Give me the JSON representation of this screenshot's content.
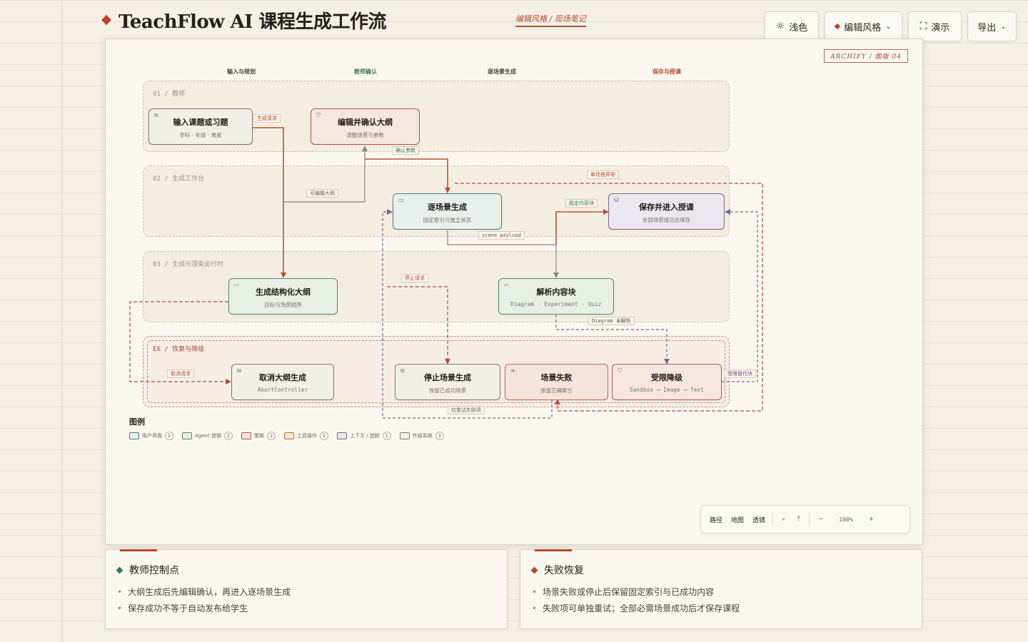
{
  "header": {
    "title": "TeachFlow AI 课程生成工作流",
    "style_note": "编辑风格 / 现场笔记"
  },
  "top_buttons": {
    "theme": "浅色",
    "theme_icon": "sun-icon",
    "style": "编辑风格",
    "present": "演示",
    "present_icon": "fullscreen-icon",
    "export": "导出"
  },
  "canvas": {
    "plate": "ARCHIFY / 图版 04",
    "columns": [
      "输入与规划",
      "教师确认",
      "逐场景生成",
      "保存与授课"
    ],
    "lanes": [
      "01 / 教师",
      "02 / 生成工作台",
      "03 / 生成与渲染运行时",
      "EX / 恢复与降级"
    ]
  },
  "nodes": {
    "input": {
      "title": "输入课题或习题",
      "sub": "学科 · 年级 · 难度"
    },
    "edit": {
      "title": "编辑并确认大纲",
      "sub": "调整场景与参数"
    },
    "scene": {
      "title": "逐场景生成",
      "sub": "固定索引与独立状态"
    },
    "save": {
      "title": "保存并进入授课",
      "sub": "全部场景成功后保存"
    },
    "outline": {
      "title": "生成结构化大纲",
      "sub": "目标与场景顺序"
    },
    "parse": {
      "title": "解析内容块",
      "sub": "Diagram · Experiment · Quiz"
    },
    "cancel": {
      "title": "取消大纲生成",
      "sub": "AbortController"
    },
    "stop": {
      "title": "停止场景生成",
      "sub": "保留已成功场景"
    },
    "fail": {
      "title": "场景失败",
      "sub": "保留正确索引"
    },
    "degrade": {
      "title": "受限降级",
      "sub": "Sandbox → Image → Text"
    }
  },
  "edges": {
    "gen_request": "生成请求",
    "confirm_params": "确认参数",
    "editable_outline": "可编辑大纲",
    "single_scene": "单场景异常",
    "stable_blocks": "稳定内容块",
    "scene_payload": "scene payload",
    "stop_request": "停止请求",
    "diagram_unparsed": "Diagram 未解析",
    "cancel_request": "取消请求",
    "restricted_alt": "受限替代块",
    "retry_failed": "仅重试失败项"
  },
  "legend": {
    "title": "图例",
    "items": [
      {
        "label": "用户界面",
        "count": "1",
        "fill": "#e8efec",
        "stroke": "#4a8076"
      },
      {
        "label": "Agent 逻辑",
        "count": "2",
        "fill": "#e7efe7",
        "stroke": "#5d8a66"
      },
      {
        "label": "策略",
        "count": "2",
        "fill": "#f6e6e1",
        "stroke": "#b8554a"
      },
      {
        "label": "工具操作",
        "count": "1",
        "fill": "#f5e4dc",
        "stroke": "#c66a4f"
      },
      {
        "label": "上下文 / 追踪",
        "count": "1",
        "fill": "#ece6ee",
        "stroke": "#7d6a8c"
      },
      {
        "label": "外部系统",
        "count": "3",
        "fill": "#f2efe8",
        "stroke": "#807a70"
      }
    ]
  },
  "toolbar": {
    "path": "路径",
    "map": "地图",
    "lens": "透镜",
    "search_icon": "search-icon",
    "help_icon": "help-icon",
    "zoom": "100%"
  },
  "cards": [
    {
      "title": "教师控制点",
      "items": [
        "大纲生成后先编辑确认，再进入逐场景生成",
        "保存成功不等于自动发布给学生"
      ]
    },
    {
      "title": "失败恢复",
      "items": [
        "场景失败或停止后保留固定索引与已成功内容",
        "失败项可单独重试；全部必需场景成功后才保存课程"
      ]
    }
  ],
  "colors": {
    "accent": "#b9472b",
    "accent_green": "#3f7a55",
    "edge_red": "#b5532f",
    "edge_gray": "#8a847a",
    "edge_purple": "#7a6490",
    "edge_dashed_red": "#b24a40"
  }
}
